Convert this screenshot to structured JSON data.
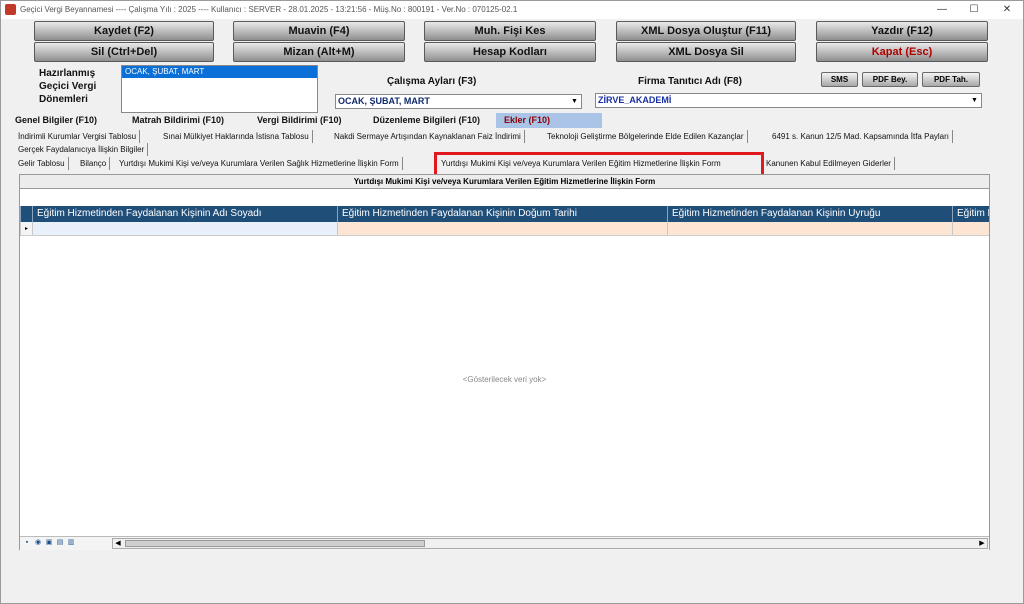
{
  "window": {
    "title": "Geçici Vergi Beyannamesi   ----   Çalışma Yılı : 2025   ----   Kullanıcı : SERVER - 28.01.2025 - 13:21:56  - Müş.No : 800191  - Ver.No : 070125-02.1",
    "minimize": "—",
    "maximize": "☐",
    "close": "✕"
  },
  "toolbar": {
    "row1": [
      "Kaydet (F2)",
      "Muavin (F4)",
      "Muh. Fişi Kes",
      "XML Dosya Oluştur (F11)",
      "Yazdır (F12)"
    ],
    "row2": [
      "Sil (Ctrl+Del)",
      "Mizan (Alt+M)",
      "Hesap Kodları",
      "XML Dosya Sil",
      "Kapat (Esc)"
    ]
  },
  "periods": {
    "label_line1": "Hazırlanmış",
    "label_line2": "Geçici Vergi",
    "label_line3": "Dönemleri",
    "items": [
      "OCAK, ŞUBAT, MART"
    ]
  },
  "work_months": {
    "label": "Çalışma Ayları (F3)",
    "value": "OCAK, ŞUBAT, MART"
  },
  "firm": {
    "label": "Firma Tanıtıcı Adı (F8)",
    "value": "ZİRVE_AKADEMİ"
  },
  "small_buttons": [
    "SMS",
    "PDF Bey.",
    "PDF Tah."
  ],
  "main_tabs": [
    "Genel Bilgiler (F10)",
    "Matrah Bildirimi (F10)",
    "Vergi Bildirimi (F10)",
    "Düzenleme Bilgileri (F10)",
    "Ekler (F10)"
  ],
  "sub_tabs_row1": [
    "İndirimli Kurumlar Vergisi Tablosu",
    "Sınai Mülkiyet Haklarında İstisna Tablosu",
    "Nakdi Sermaye Artışından Kaynaklanan Faiz İndirimi",
    "Teknoloji Geliştirme Bölgelerinde Elde Edilen Kazançlar",
    "6491 s. Kanun 12/5 Mad. Kapsamında İtfa Payları"
  ],
  "sub_tabs_row2": [
    "Gerçek Faydalanıcıya İlişkin Bilgiler"
  ],
  "sub_tabs_row3": [
    "Gelir Tablosu",
    "Bilanço",
    "Yurtdışı Mukimi Kişi ve/veya Kurumlara Verilen Sağlık Hizmetlerine İlişkin Form",
    "Yurtdışı Mukimi Kişi ve/veya Kurumlara Verilen Eğitim Hizmetlerine İlişkin Form",
    "Kanunen Kabul Edilmeyen Giderler"
  ],
  "form": {
    "title": "Yurtdışı Mukimi Kişi ve/veya Kurumlara Verilen Eğitim Hizmetlerine İlişkin Form",
    "columns": [
      "Eğitim Hizmetinden Faydalanan Kişinin Adı Soyadı",
      "Eğitim Hizmetinden Faydalanan Kişinin Doğum Tarihi",
      "Eğitim Hizmetinden Faydalanan Kişinin Uyruğu",
      "Eğitim H"
    ],
    "empty_message": "<Gösterilecek veri yok>"
  },
  "colors": {
    "header_blue": "#1f4e79",
    "active_tab": "#aac4e8",
    "highlight": "#e0191f",
    "row_peach": "#fde5d3",
    "row_blue": "#e8f0fb"
  }
}
